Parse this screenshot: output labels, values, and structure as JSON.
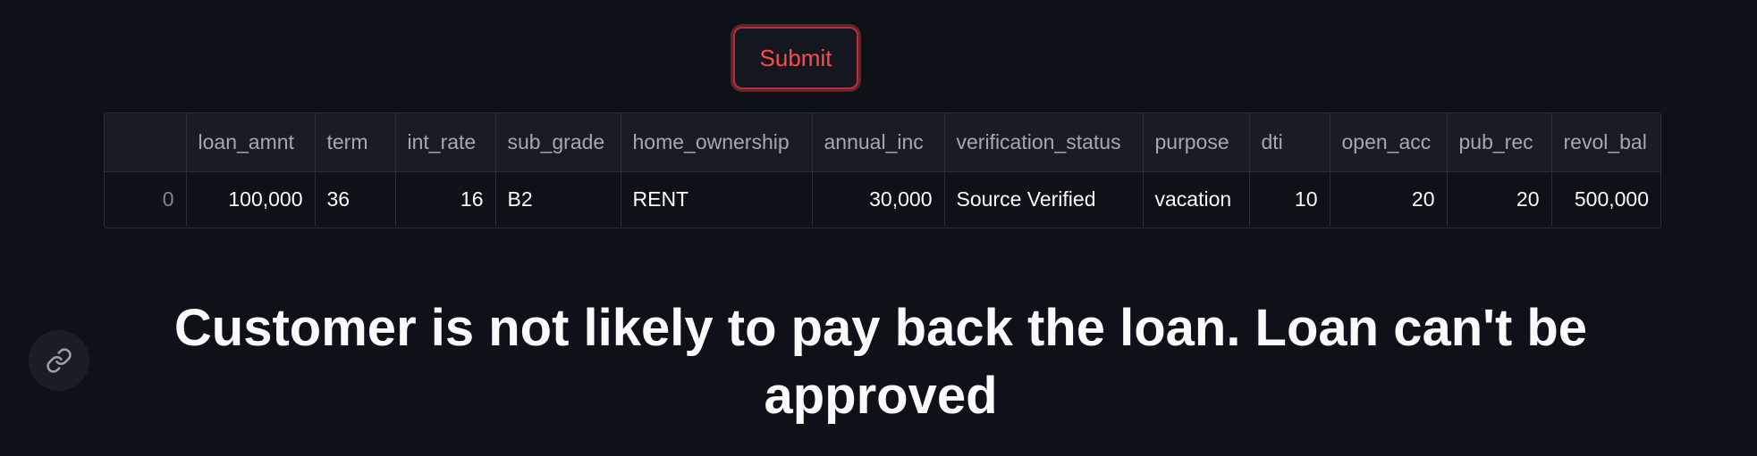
{
  "submit_button": {
    "label": "Submit"
  },
  "table": {
    "columns": [
      "",
      "loan_amnt",
      "term",
      "int_rate",
      "sub_grade",
      "home_ownership",
      "annual_inc",
      "verification_status",
      "purpose",
      "dti",
      "open_acc",
      "pub_rec",
      "revol_bal"
    ],
    "rows": [
      [
        "0",
        "100,000",
        "36",
        "16",
        "B2",
        "RENT",
        "30,000",
        "Source Verified",
        "vacation",
        "10",
        "20",
        "20",
        "500,000"
      ]
    ]
  },
  "result": {
    "message": "Customer is not likely to pay back the loan. Loan can't be approved"
  },
  "icons": {
    "anchor_link": "link-icon"
  },
  "colors": {
    "background": "#0e1117",
    "accent": "#ff4b4b",
    "text": "#fafafa"
  }
}
